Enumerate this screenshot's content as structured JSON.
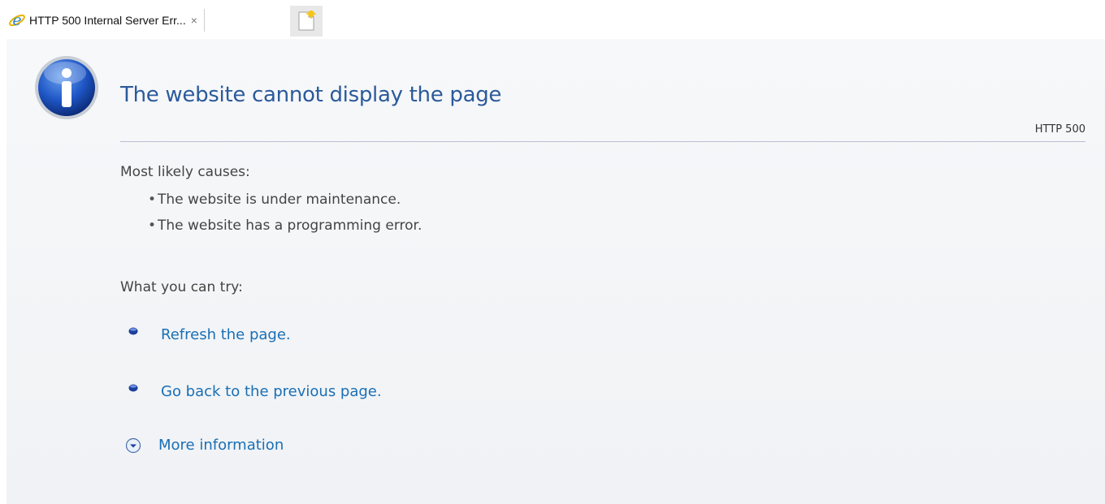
{
  "tab": {
    "title": "HTTP 500 Internal Server Err...",
    "close": "×"
  },
  "page": {
    "heading": "The website cannot display the page",
    "code": "HTTP 500",
    "causes_label": "Most likely causes:",
    "causes": [
      "The website is under maintenance.",
      "The website has a programming error."
    ],
    "try_label": "What you can try:",
    "actions": [
      "Refresh the page.",
      "Go back to the previous page."
    ],
    "more_info": "More information"
  },
  "colors": {
    "heading": "#2b5a9b",
    "link": "#1a6fb5",
    "text": "#444444"
  },
  "icons": {
    "tab_icon": "internet-explorer-icon",
    "new_tab": "new-tab-icon",
    "info": "info-icon",
    "bullet": "blue-bullet-icon",
    "expand": "chevron-down-circle-icon"
  }
}
